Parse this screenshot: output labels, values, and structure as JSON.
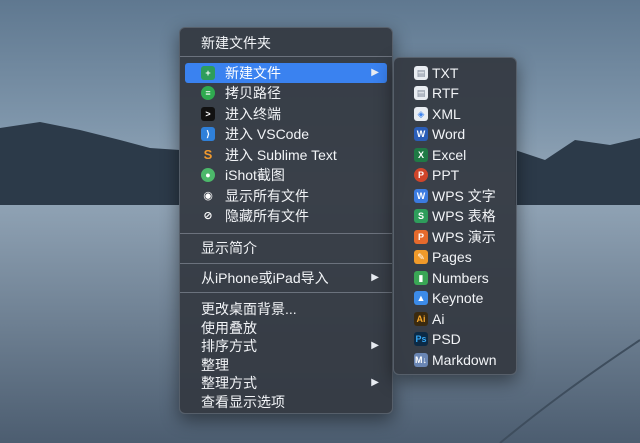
{
  "main_menu": {
    "items": [
      {
        "label": "新建文件夹",
        "icon": null,
        "has_submenu": false,
        "highlighted": false
      },
      {
        "label": "新建文件",
        "icon": "new-file-icon",
        "has_submenu": true,
        "highlighted": true
      },
      {
        "label": "拷贝路径",
        "icon": "copy-path-icon",
        "has_submenu": false,
        "highlighted": false
      },
      {
        "label": "进入终端",
        "icon": "terminal-icon",
        "has_submenu": false,
        "highlighted": false
      },
      {
        "label": "进入 VSCode",
        "icon": "vscode-icon",
        "has_submenu": false,
        "highlighted": false
      },
      {
        "label": "进入 Sublime Text",
        "icon": "sublime-icon",
        "has_submenu": false,
        "highlighted": false
      },
      {
        "label": "iShot截图",
        "icon": "ishot-icon",
        "has_submenu": false,
        "highlighted": false
      },
      {
        "label": "显示所有文件",
        "icon": "eye-icon",
        "has_submenu": false,
        "highlighted": false
      },
      {
        "label": "隐藏所有文件",
        "icon": "eye-slash-icon",
        "has_submenu": false,
        "highlighted": false
      },
      {
        "label": "显示简介",
        "icon": null,
        "has_submenu": false,
        "highlighted": false
      },
      {
        "label": "从iPhone或iPad导入",
        "icon": null,
        "has_submenu": true,
        "highlighted": false
      },
      {
        "label": "更改桌面背景...",
        "icon": null,
        "has_submenu": false,
        "highlighted": false
      },
      {
        "label": "使用叠放",
        "icon": null,
        "has_submenu": false,
        "highlighted": false
      },
      {
        "label": "排序方式",
        "icon": null,
        "has_submenu": true,
        "highlighted": false
      },
      {
        "label": "整理",
        "icon": null,
        "has_submenu": false,
        "highlighted": false
      },
      {
        "label": "整理方式",
        "icon": null,
        "has_submenu": true,
        "highlighted": false
      },
      {
        "label": "查看显示选项",
        "icon": null,
        "has_submenu": false,
        "highlighted": false
      }
    ],
    "submenu_arrow": "▶"
  },
  "sub_menu": {
    "items": [
      {
        "label": "TXT",
        "icon": "txt-file-icon",
        "color": "#e9edf2"
      },
      {
        "label": "RTF",
        "icon": "rtf-file-icon",
        "color": "#e9edf2"
      },
      {
        "label": "XML",
        "icon": "xml-file-icon",
        "color": "#e9edf2"
      },
      {
        "label": "Word",
        "icon": "word-icon",
        "color": "#2b5eb8"
      },
      {
        "label": "Excel",
        "icon": "excel-icon",
        "color": "#1f7a45"
      },
      {
        "label": "PPT",
        "icon": "ppt-icon",
        "color": "#d0452a"
      },
      {
        "label": "WPS 文字",
        "icon": "wps-writer-icon",
        "color": "#3b7be0"
      },
      {
        "label": "WPS 表格",
        "icon": "wps-sheet-icon",
        "color": "#2e9d5b"
      },
      {
        "label": "WPS 演示",
        "icon": "wps-slides-icon",
        "color": "#e66a2c"
      },
      {
        "label": "Pages",
        "icon": "pages-icon",
        "color": "#f09a2a"
      },
      {
        "label": "Numbers",
        "icon": "numbers-icon",
        "color": "#3aa655"
      },
      {
        "label": "Keynote",
        "icon": "keynote-icon",
        "color": "#3c8be8"
      },
      {
        "label": "Ai",
        "icon": "illustrator-icon",
        "color": "#3a2a10"
      },
      {
        "label": "PSD",
        "icon": "photoshop-icon",
        "color": "#0c2a45"
      },
      {
        "label": "Markdown",
        "icon": "markdown-icon",
        "color": "#6a86b4"
      }
    ]
  }
}
